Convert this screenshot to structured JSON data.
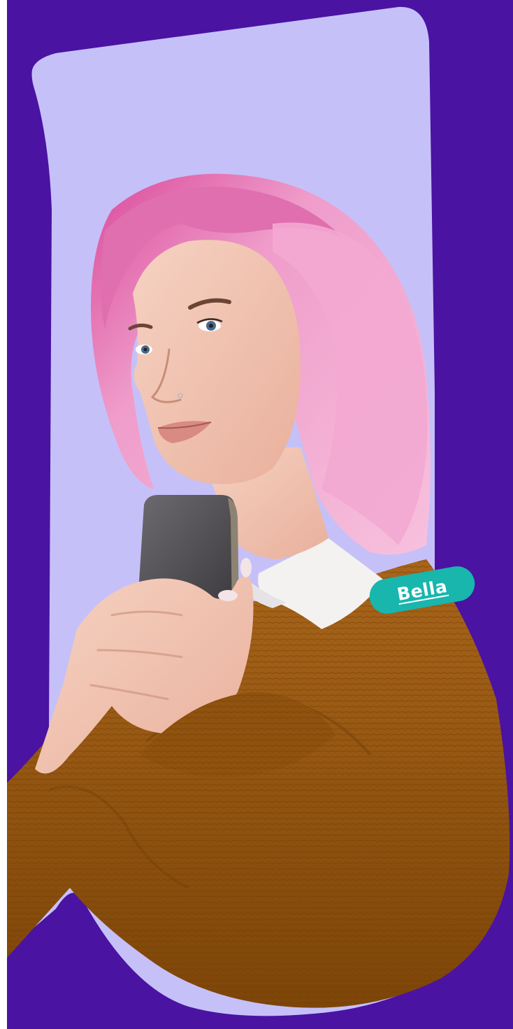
{
  "profile": {
    "name": "Bella"
  },
  "colors": {
    "background": "#4a13a2",
    "card": "#c6c0f8",
    "tag": "#18b6ad",
    "hair": "#ef9cca",
    "sweater": "#9a5b12"
  },
  "icons": {
    "portrait": "person-portrait-photo"
  }
}
